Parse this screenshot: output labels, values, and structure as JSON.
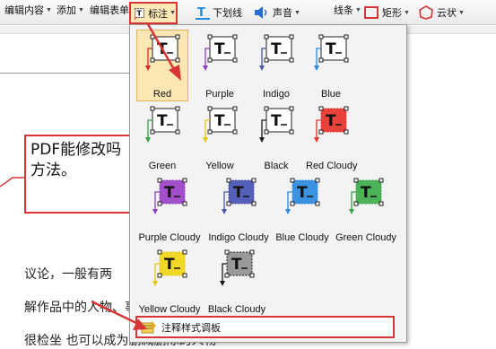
{
  "toolbar": {
    "edit_content": "编辑内容",
    "add": "添加",
    "edit_form": "编辑表单",
    "callout": "标注",
    "underline": "下划线",
    "sound": "声音",
    "line": "线条",
    "rectangle": "矩形",
    "cloud": "云状"
  },
  "document": {
    "callout_text_line1": "PDF能修改吗",
    "callout_text_line2": "方法。",
    "line1": "议论，一般有两",
    "line2": "解作品中的人物、事",
    "line3": "很检坐   也可以成为删减删除的人物"
  },
  "colors": {
    "accent_red": "#d83636",
    "selected_bg": "#fbe7b4"
  },
  "menu": {
    "styles": [
      {
        "label": "Red",
        "color": "#d7262c",
        "fill": "none",
        "selected": true
      },
      {
        "label": "Purple",
        "color": "#8d3fb6",
        "fill": "none",
        "selected": false
      },
      {
        "label": "Indigo",
        "color": "#4b56a8",
        "fill": "none",
        "selected": false
      },
      {
        "label": "Blue",
        "color": "#2f86d6",
        "fill": "none",
        "selected": false
      },
      {
        "label": "Green",
        "color": "#35a044",
        "fill": "none",
        "selected": false
      },
      {
        "label": "Yellow",
        "color": "#e2c514",
        "fill": "none",
        "selected": false
      },
      {
        "label": "Black",
        "color": "#1a1a1a",
        "fill": "none",
        "selected": false
      },
      {
        "label": "Red Cloudy",
        "color": "#e0342e",
        "fill": "#e8423a",
        "selected": false
      },
      {
        "label": "Purple Cloudy",
        "color": "#8d3fb6",
        "fill": "#a24fcb",
        "selected": false
      },
      {
        "label": "Indigo Cloudy",
        "color": "#4b56a8",
        "fill": "#5560b8",
        "selected": false
      },
      {
        "label": "Blue Cloudy",
        "color": "#2f86d6",
        "fill": "#3a92e0",
        "selected": false
      },
      {
        "label": "Green Cloudy",
        "color": "#35a044",
        "fill": "#4db359",
        "selected": false
      },
      {
        "label": "Yellow Cloudy",
        "color": "#e2c514",
        "fill": "#f2d928",
        "selected": false
      },
      {
        "label": "Black Cloudy",
        "color": "#1a1a1a",
        "fill": "#9a9a9a",
        "selected": false
      }
    ],
    "manager_label": "注释样式调板"
  }
}
